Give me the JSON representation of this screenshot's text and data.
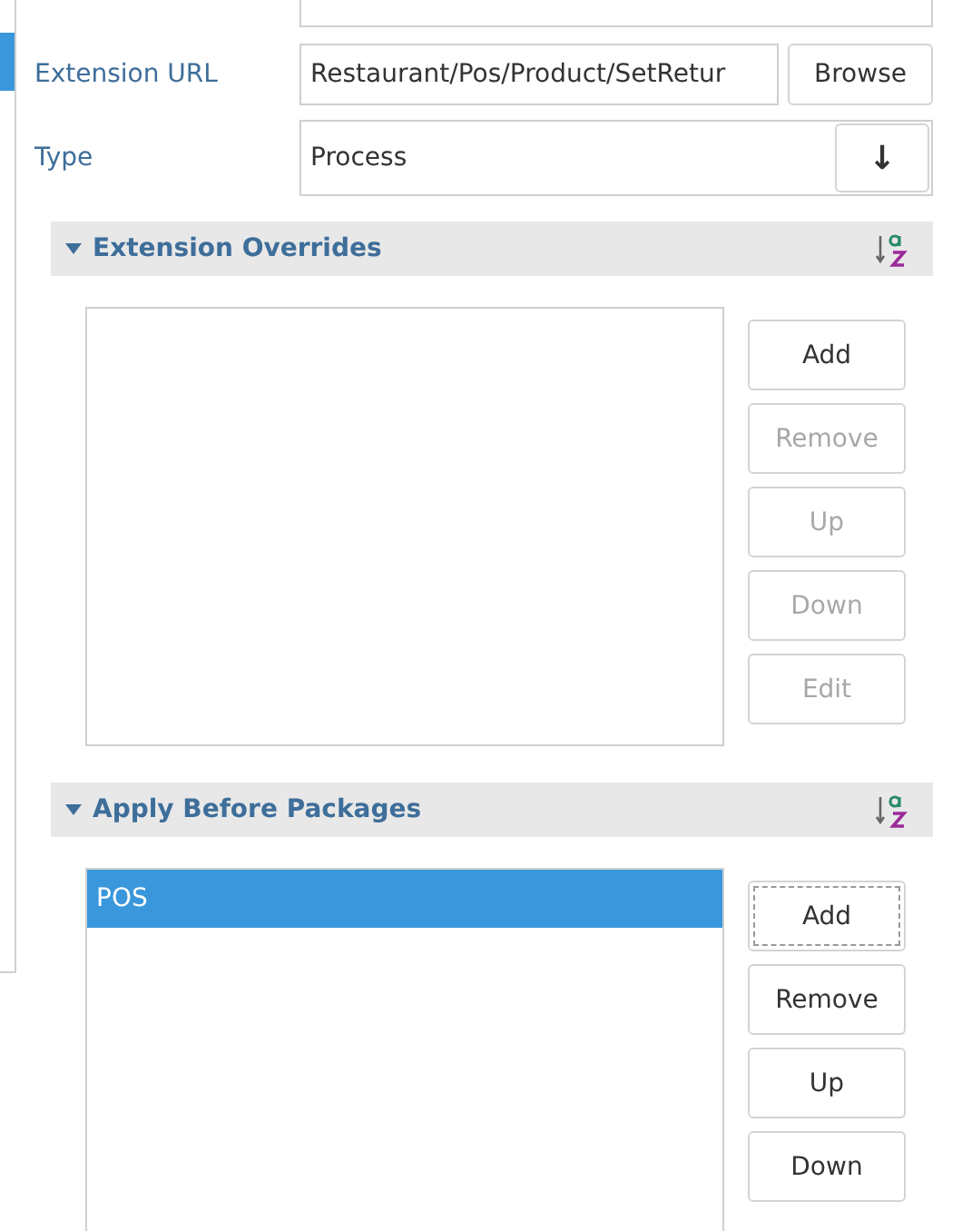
{
  "form": {
    "rows": [
      {
        "label": "Extension URL",
        "value": "Restaurant/Pos/Product/SetRetur",
        "kind": "browse",
        "button": "Browse"
      },
      {
        "label": "Type",
        "value": "Process",
        "kind": "select",
        "button": "↓"
      }
    ]
  },
  "sections": [
    {
      "title": "Extension Overrides",
      "expanded": true,
      "buttons": [
        {
          "label": "Add",
          "disabled": false,
          "focused": false
        },
        {
          "label": "Remove",
          "disabled": true,
          "focused": false
        },
        {
          "label": "Up",
          "disabled": true,
          "focused": false
        },
        {
          "label": "Down",
          "disabled": true,
          "focused": false
        },
        {
          "label": "Edit",
          "disabled": true,
          "focused": false
        }
      ]
    },
    {
      "title": "Apply Before Packages",
      "expanded": true,
      "items": [
        {
          "label": "POS",
          "selected": true
        }
      ],
      "buttons": [
        {
          "label": "Add",
          "disabled": false,
          "focused": true
        },
        {
          "label": "Remove",
          "disabled": false,
          "focused": false
        },
        {
          "label": "Up",
          "disabled": false,
          "focused": false
        },
        {
          "label": "Down",
          "disabled": false,
          "focused": false
        }
      ]
    }
  ]
}
